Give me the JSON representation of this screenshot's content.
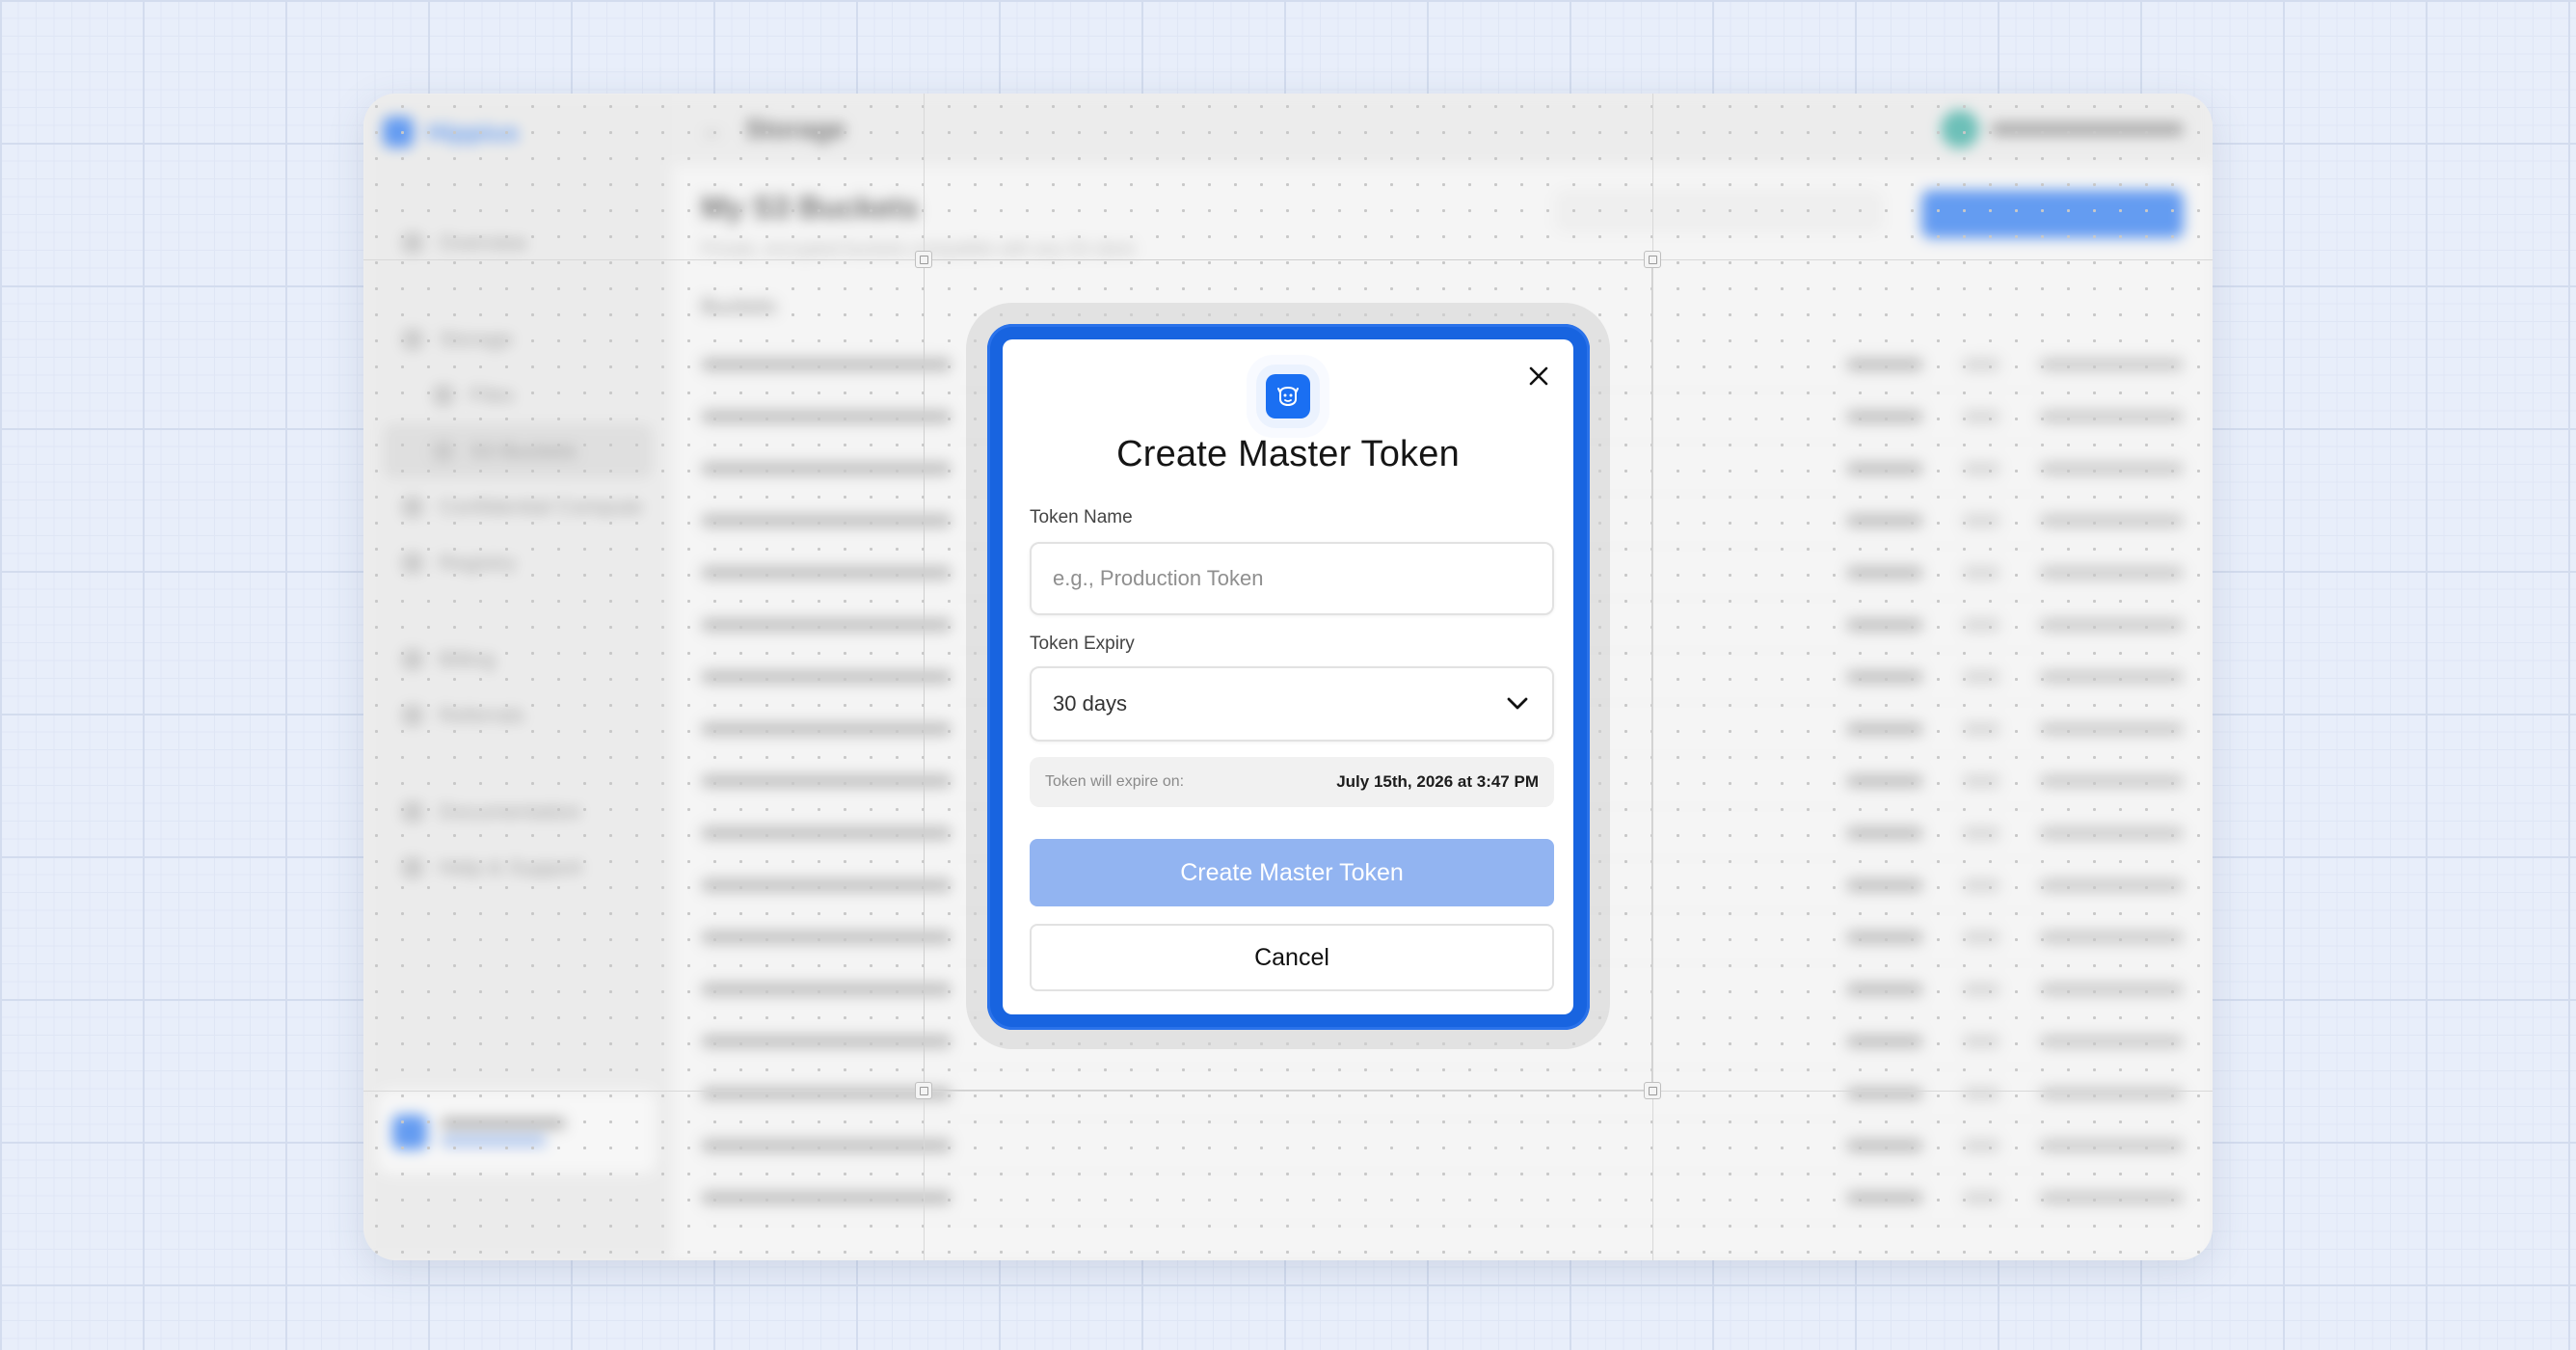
{
  "background_app": {
    "brand": "Hippius",
    "breadcrumb": "Storage",
    "page_title": "My S3 Buckets",
    "page_subtitle": "Private, encrypted buckets compatible with any S3 client",
    "nav_items": [
      "Overview",
      "Storage",
      "Files",
      "S3 Buckets",
      "Confidential Compute",
      "Registry",
      "Billing",
      "Referrals",
      "Documentation",
      "Help & Support"
    ],
    "section_label": "Buckets"
  },
  "modal": {
    "title": "Create Master Token",
    "token_name_label": "Token Name",
    "token_name_placeholder": "e.g., Production Token",
    "token_name_value": "",
    "token_expiry_label": "Token Expiry",
    "token_expiry_value": "30 days",
    "expire_notice_label": "Token will expire on:",
    "expire_notice_date": "July 15th, 2026 at 3:47 PM",
    "primary_button": "Create Master Token",
    "cancel_button": "Cancel"
  },
  "colors": {
    "accent": "#1864e0",
    "primary_button_disabled": "#92b4f1",
    "logo_bg": "#1a6ff2"
  },
  "icons": {
    "close": "close-icon",
    "chevron": "chevron-down-icon",
    "logo": "app-logo-icon"
  }
}
